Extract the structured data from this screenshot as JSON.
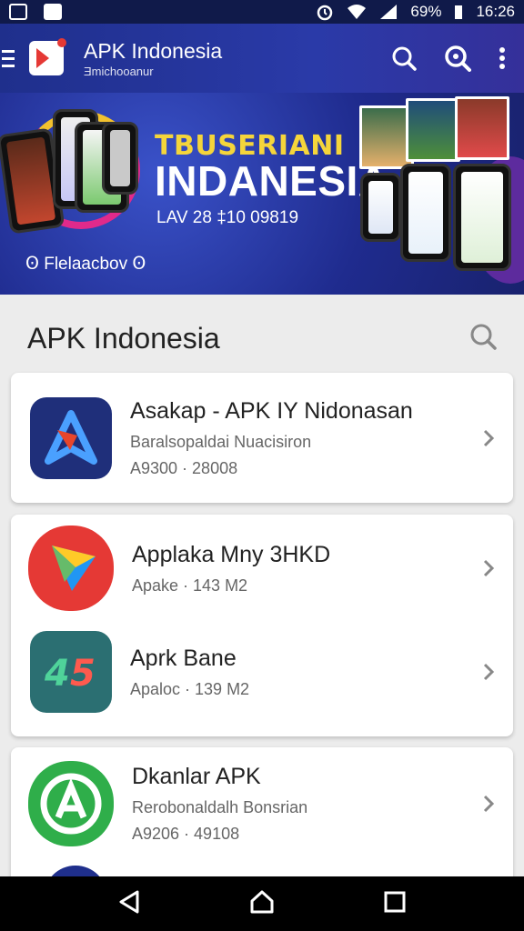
{
  "status_bar": {
    "battery": "69%",
    "time": "16:26"
  },
  "app_bar": {
    "title": "APK Indonesia",
    "subtitle": "Ǝmichooanur",
    "menu_icon": "menu-icon",
    "actions": [
      {
        "name": "search-icon"
      },
      {
        "name": "search-alt-icon"
      },
      {
        "name": "more-vert-icon"
      }
    ]
  },
  "banner": {
    "kicker": "TBUSERIANI",
    "headline": "INDANESIA",
    "date": "LAV 28 ‡10 09819",
    "footer": "Ꙩ Flelaacbov Ꙩ"
  },
  "section": {
    "title": "APK Indonesia"
  },
  "apps": [
    {
      "title": "Asakap - APK IY Nidonasan",
      "subtitle": "Baralsopaldai Nuacisiron",
      "meta": "A9300 · 28008",
      "icon": "arrow-a-icon",
      "color": "#1f2f7a"
    },
    {
      "title": "Applaka Mny 3HKD",
      "subtitle": "Apake · 143 M2",
      "meta": "",
      "icon": "play-store-icon",
      "color": "#e53935"
    },
    {
      "title": "Aprk Bane",
      "subtitle": "Apaloc · 139 M2",
      "meta": "",
      "icon": "ab-logo-icon",
      "color": "#2b6f72"
    },
    {
      "title": "Dkanlar APK",
      "subtitle": "Rerobonaldalh Bonsrian",
      "meta": "A9206 · 49108",
      "icon": "a-circle-icon",
      "color": "#2fae4a"
    }
  ],
  "nav": {
    "back": "back-icon",
    "home": "home-icon",
    "recents": "recents-icon"
  }
}
